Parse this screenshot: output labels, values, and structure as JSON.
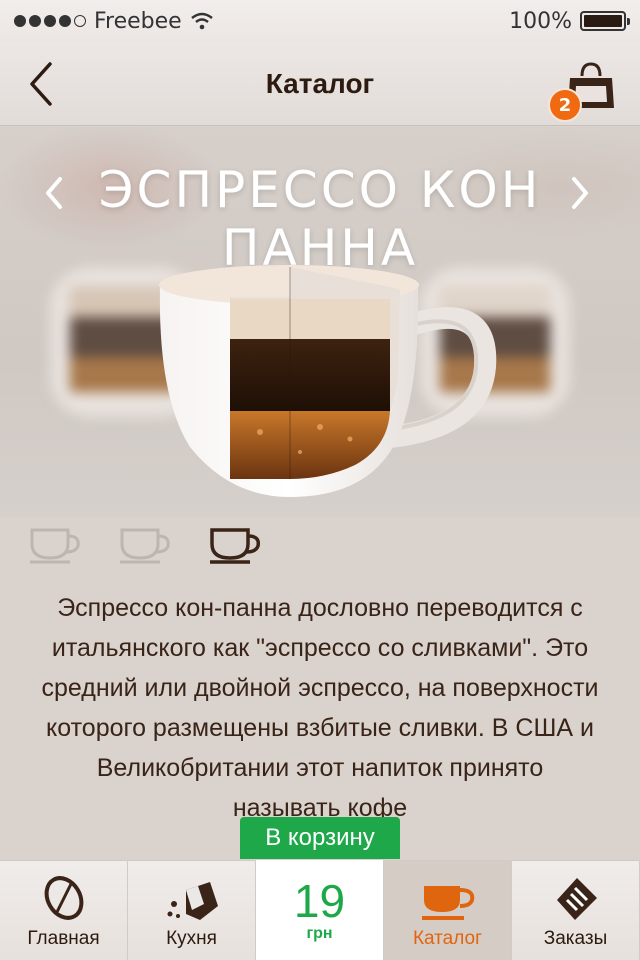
{
  "status_bar": {
    "carrier": "Freebee",
    "battery": "100%",
    "signal_dots": 5,
    "signal_filled": 4
  },
  "nav": {
    "title": "Каталог",
    "cart_count": "2"
  },
  "product": {
    "title": "ЭСПРЕССО КОН ПАННА",
    "description": "Эспрессо кон-панна дословно переводится с итальянского как \"эспрессо со сливками\". Это средний или двойной эспрессо, на поверхности которого размещены взбитые сливки. В США и Великобритании этот напиток принято называть кофе",
    "sizes": [
      "small",
      "medium",
      "large"
    ],
    "selected_size": "large"
  },
  "add_to_cart_label": "В корзину",
  "price": {
    "value": "19",
    "unit": "грн"
  },
  "tabs": [
    {
      "label": "Главная",
      "icon": "coffee-bean-icon"
    },
    {
      "label": "Кухня",
      "icon": "kitchen-icon"
    },
    {
      "label": "Каталог",
      "icon": "cup-icon",
      "active": true
    },
    {
      "label": "Заказы",
      "icon": "orders-icon"
    }
  ],
  "colors": {
    "accent": "#ef6a10",
    "price_green": "#1ea84a",
    "brown": "#3a2418"
  }
}
